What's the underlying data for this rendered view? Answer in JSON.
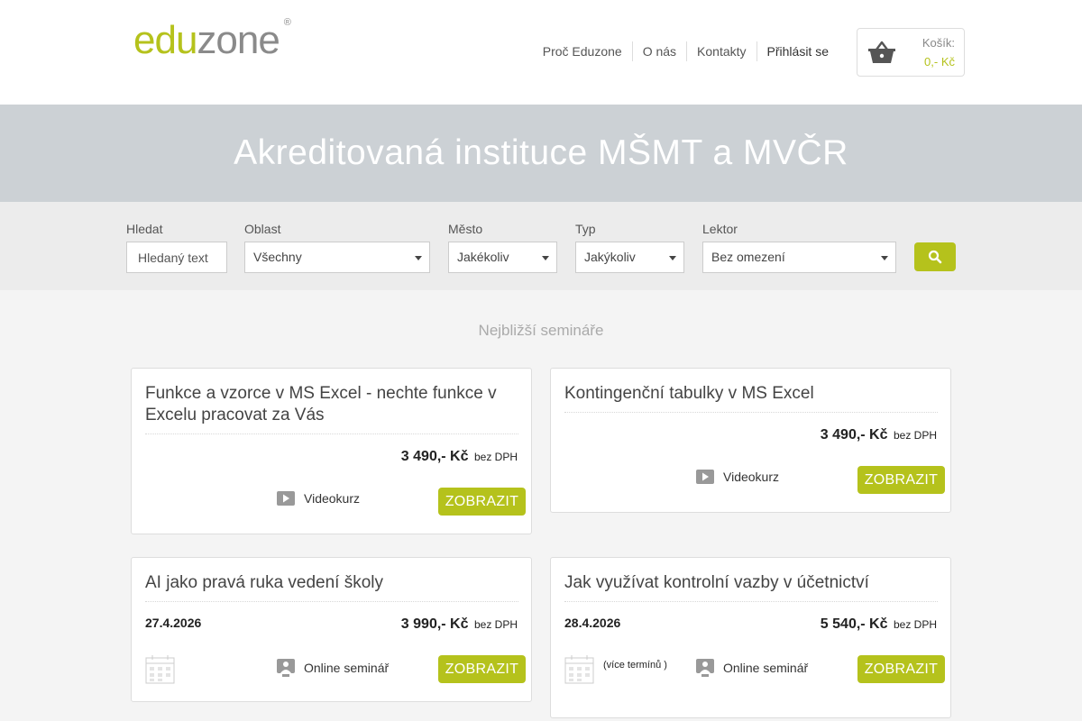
{
  "header": {
    "logo": {
      "edu": "edu",
      "zone": "zone",
      "reg": "®"
    },
    "nav": [
      {
        "label": "Proč Eduzone"
      },
      {
        "label": "O nás"
      },
      {
        "label": "Kontakty"
      },
      {
        "label": "Přihlásit se"
      }
    ],
    "cart": {
      "label": "Košík:",
      "price": "0,- Kč",
      "icon": "basket-icon"
    }
  },
  "hero": {
    "title": "Akreditovaná instituce MŠMT a MVČR"
  },
  "search": {
    "fields": {
      "hledat": {
        "label": "Hledat",
        "placeholder": "Hledaný text"
      },
      "oblast": {
        "label": "Oblast",
        "value": "Všechny"
      },
      "mesto": {
        "label": "Město",
        "value": "Jakékoliv"
      },
      "typ": {
        "label": "Typ",
        "value": "Jakýkoliv"
      },
      "lektor": {
        "label": "Lektor",
        "value": "Bez omezení"
      }
    },
    "button_icon": "search-icon"
  },
  "main": {
    "section_title": "Nejbližší semináře",
    "cards": [
      {
        "title": "Funkce a vzorce v MS Excel - nechte funkce v Excelu pracovat za Vás",
        "price": "3 490,- Kč",
        "vat": "bez DPH",
        "type": "Videokurz",
        "button": "ZOBRAZIT"
      },
      {
        "title": "Kontingenční tabulky v MS Excel",
        "price": "3 490,- Kč",
        "vat": "bez DPH",
        "type": "Videokurz",
        "button": "ZOBRAZIT"
      },
      {
        "title": "AI jako pravá ruka vedení školy",
        "date": "27.4.2026",
        "price": "3 990,- Kč",
        "vat": "bez DPH",
        "type": "Online seminář",
        "button": "ZOBRAZIT"
      },
      {
        "title": "Jak využívat kontrolní vazby v účetnictví",
        "date": "28.4.2026",
        "more": "(více termínů )",
        "price": "5 540,- Kč",
        "vat": "bez DPH",
        "type": "Online seminář",
        "button": "ZOBRAZIT"
      }
    ]
  },
  "colors": {
    "accent": "#b5c21c",
    "hero_bg": "#ccd1d5",
    "logo_gray": "#8a8a8a"
  }
}
